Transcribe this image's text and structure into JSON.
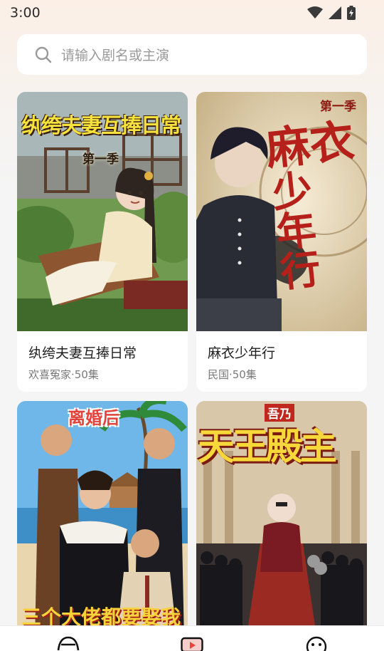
{
  "status_bar": {
    "time": "3:00",
    "icons": [
      "wifi-icon",
      "signal-icon",
      "battery-icon"
    ]
  },
  "search": {
    "placeholder": "请输入剧名或主演",
    "icon": "search-icon"
  },
  "dramas": [
    {
      "title": "纨绔夫妻互捧日常",
      "genre": "欢喜冤家",
      "episodes": "50集",
      "meta": "欢喜冤家·50集",
      "cover_title": "纨绔夫妻互捧日常",
      "cover_subtitle": "第一季"
    },
    {
      "title": "麻衣少年行",
      "genre": "民国",
      "episodes": "50集",
      "meta": "民国·50集",
      "cover_title_line1": "麻衣",
      "cover_title_line2": "少年行",
      "cover_subtitle": "第一季"
    },
    {
      "cover_title": "离婚后",
      "cover_bottom": "三个大佬都要娶我"
    },
    {
      "cover_top": "吾乃",
      "cover_title": "天王殿主"
    }
  ],
  "bottom_nav": {
    "items": [
      "home-icon",
      "theater-icon",
      "profile-icon"
    ]
  },
  "colors": {
    "accent": "#e8433f",
    "text_primary": "#1f1f1f",
    "text_secondary": "#7a7a7a"
  }
}
